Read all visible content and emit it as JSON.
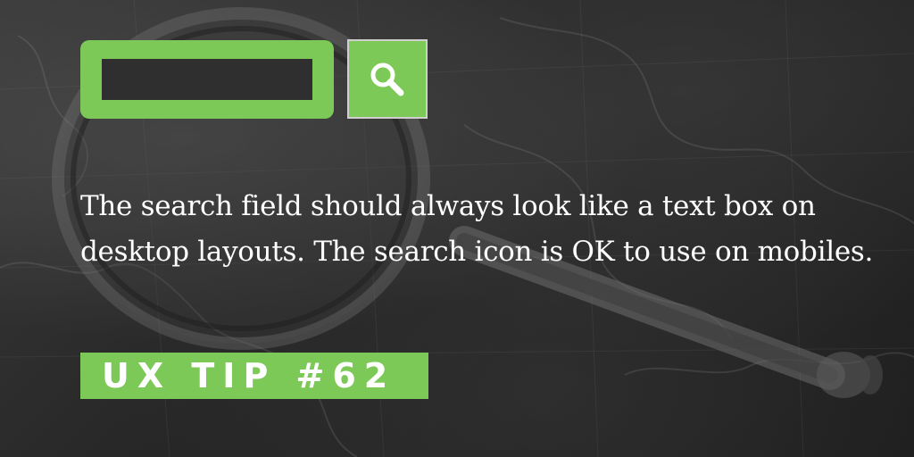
{
  "background": {
    "description_icon": "antique-map-with-magnifying-glass"
  },
  "search": {
    "field_value": "",
    "button_icon": "search-icon"
  },
  "tip": {
    "text": "The search field should always look like a text box on desktop layouts. The search icon is OK to use on mobiles.",
    "badge": "UX TIP #62"
  },
  "colors": {
    "accent": "#7cc957",
    "text": "#ffffff",
    "background": "#2b2b2b"
  }
}
